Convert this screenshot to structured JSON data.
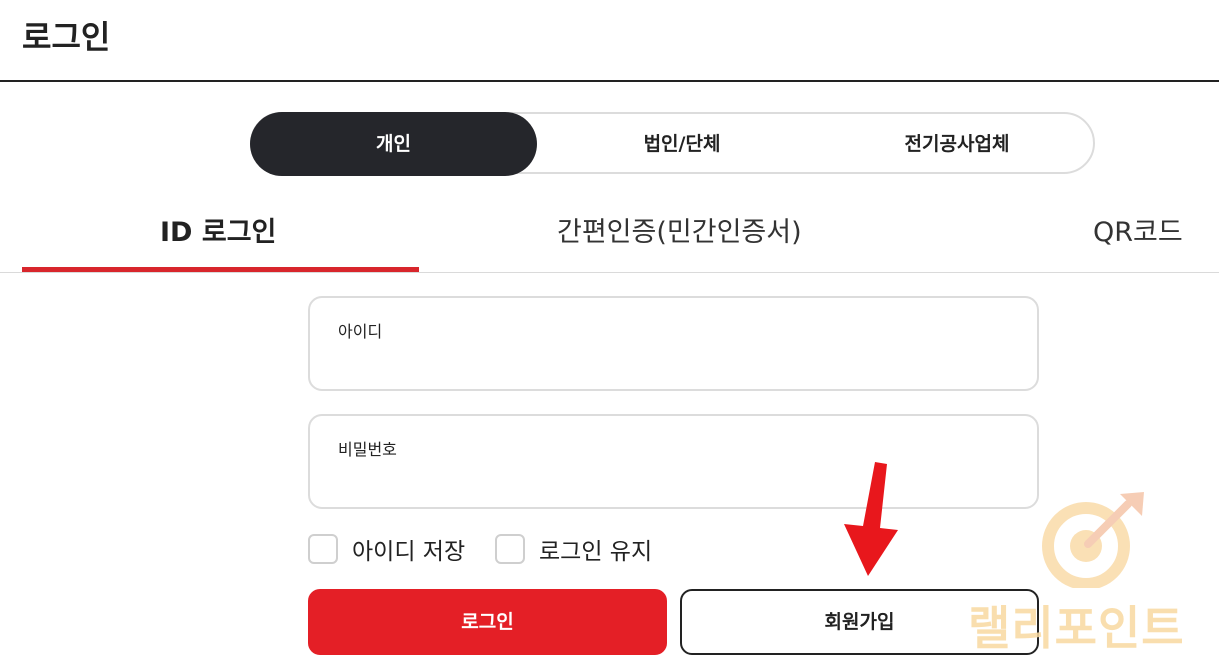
{
  "header": {
    "title": "로그인"
  },
  "member_type": {
    "options": [
      {
        "label": "개인",
        "active": true
      },
      {
        "label": "법인/단체",
        "active": false
      },
      {
        "label": "전기공사업체",
        "active": false
      }
    ]
  },
  "login_tabs": {
    "items": [
      {
        "label": "ID 로그인",
        "active": true
      },
      {
        "label": "간편인증(민간인증서)",
        "active": false
      },
      {
        "label": "QR코드",
        "active": false
      }
    ],
    "accent_color": "#d8262c"
  },
  "form": {
    "id_label": "아이디",
    "id_value": "",
    "password_label": "비밀번호",
    "password_value": "",
    "save_id_label": "아이디 저장",
    "save_id_checked": false,
    "keep_login_label": "로그인 유지",
    "keep_login_checked": false
  },
  "actions": {
    "login_label": "로그인",
    "signup_label": "회원가입",
    "login_color": "#e41f26"
  },
  "annotation": {
    "arrow_color": "#e8171c",
    "arrow_icon": "arrow-down-icon"
  },
  "watermark": {
    "text": "랠리포인트",
    "icon": "target-arrow-icon"
  }
}
